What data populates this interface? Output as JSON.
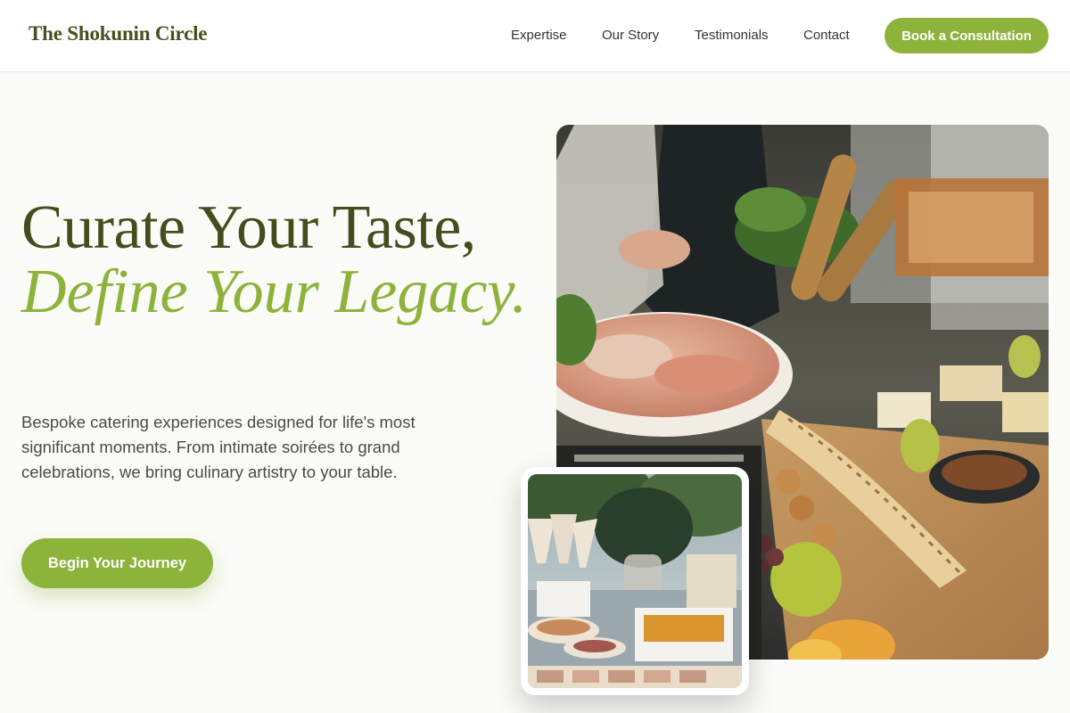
{
  "nav": {
    "brand": "The Shokunin Circle",
    "links": [
      "Expertise",
      "Our Story",
      "Testimonials",
      "Contact"
    ],
    "cta_label": "Book a Consultation"
  },
  "hero": {
    "headline_line1": "Curate Your Taste,",
    "headline_accent": "Define Your Legacy.",
    "description": "Bespoke catering experiences designed for life's most significant moments. From intimate soirées to grand celebrations, we bring culinary artistry to your table.",
    "cta_label": "Begin Your Journey"
  },
  "images": {
    "main_photo": "catering-grazing-table-photo",
    "inset_photo": "outdoor-buffet-table-photo"
  },
  "colors": {
    "accent": "#8db33a",
    "brand_dark": "#45521f",
    "background": "#fbfbf8",
    "nav_background": "#ffffff"
  }
}
